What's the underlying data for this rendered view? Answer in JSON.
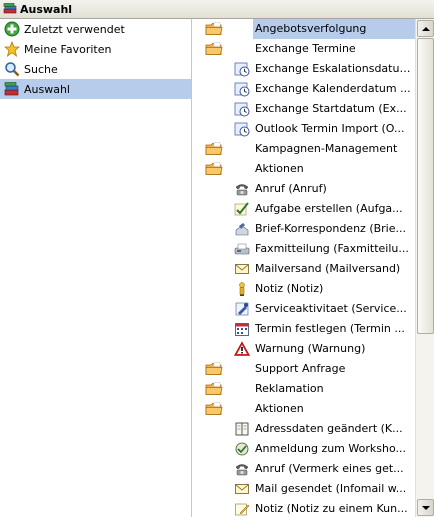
{
  "window": {
    "title": "Auswahl"
  },
  "nav": {
    "items": [
      {
        "label": "Zuletzt verwendet",
        "icon": "recent-plus-icon"
      },
      {
        "label": "Meine Favoriten",
        "icon": "star-icon"
      },
      {
        "label": "Suche",
        "icon": "magnifier-icon"
      },
      {
        "label": "Auswahl",
        "icon": "books-icon",
        "selected": true
      }
    ]
  },
  "list": {
    "rows": [
      {
        "label": "Angebotsverfolgung",
        "type": "folder",
        "selected": true
      },
      {
        "label": "Exchange Termine",
        "type": "folder"
      },
      {
        "label": "Exchange Eskalationsdatum ...",
        "type": "item",
        "icon": "clock-icon"
      },
      {
        "label": "Exchange Kalenderdatum ...",
        "type": "item",
        "icon": "clock-icon"
      },
      {
        "label": "Exchange Startdatum (Ex...",
        "type": "item",
        "icon": "clock-icon"
      },
      {
        "label": "Outlook Termin Import (O...",
        "type": "item",
        "icon": "clock-icon"
      },
      {
        "label": "Kampagnen-Management",
        "type": "folder"
      },
      {
        "label": "Aktionen",
        "type": "folder"
      },
      {
        "label": "Anruf (Anruf)",
        "type": "item",
        "icon": "phone-icon"
      },
      {
        "label": "Aufgabe erstellen (Aufga...",
        "type": "item",
        "icon": "checkmark-pen-icon"
      },
      {
        "label": "Brief-Korrespondenz (Brie...",
        "type": "item",
        "icon": "letter-hand-icon"
      },
      {
        "label": "Faxmitteilung (Faxmitteilu...",
        "type": "item",
        "icon": "fax-icon"
      },
      {
        "label": "Mailversand (Mailversand)",
        "type": "item",
        "icon": "envelope-icon"
      },
      {
        "label": "Notiz (Notiz)",
        "type": "item",
        "icon": "person-note-icon"
      },
      {
        "label": "Serviceaktivitaet (Service...",
        "type": "item",
        "icon": "service-icon"
      },
      {
        "label": "Termin festlegen (Termin ...",
        "type": "item",
        "icon": "calendar-icon"
      },
      {
        "label": "Warnung (Warnung)",
        "type": "item",
        "icon": "warning-icon"
      },
      {
        "label": "Support Anfrage",
        "type": "folder"
      },
      {
        "label": "Reklamation",
        "type": "folder"
      },
      {
        "label": "Aktionen",
        "type": "folder"
      },
      {
        "label": "Adressdaten geändert (K...",
        "type": "item",
        "icon": "address-book-icon"
      },
      {
        "label": "Anmeldung zum Worksho...",
        "type": "item",
        "icon": "registration-icon"
      },
      {
        "label": "Anruf (Vermerk eines get...",
        "type": "item",
        "icon": "phone-icon"
      },
      {
        "label": "Mail gesendet (Infomail w...",
        "type": "item",
        "icon": "envelope-icon"
      },
      {
        "label": "Notiz (Notiz zu einem Kun...",
        "type": "item",
        "icon": "pencil-note-icon"
      }
    ]
  },
  "colors": {
    "selection": "#b7cbeb",
    "folder": "#f0a030"
  }
}
